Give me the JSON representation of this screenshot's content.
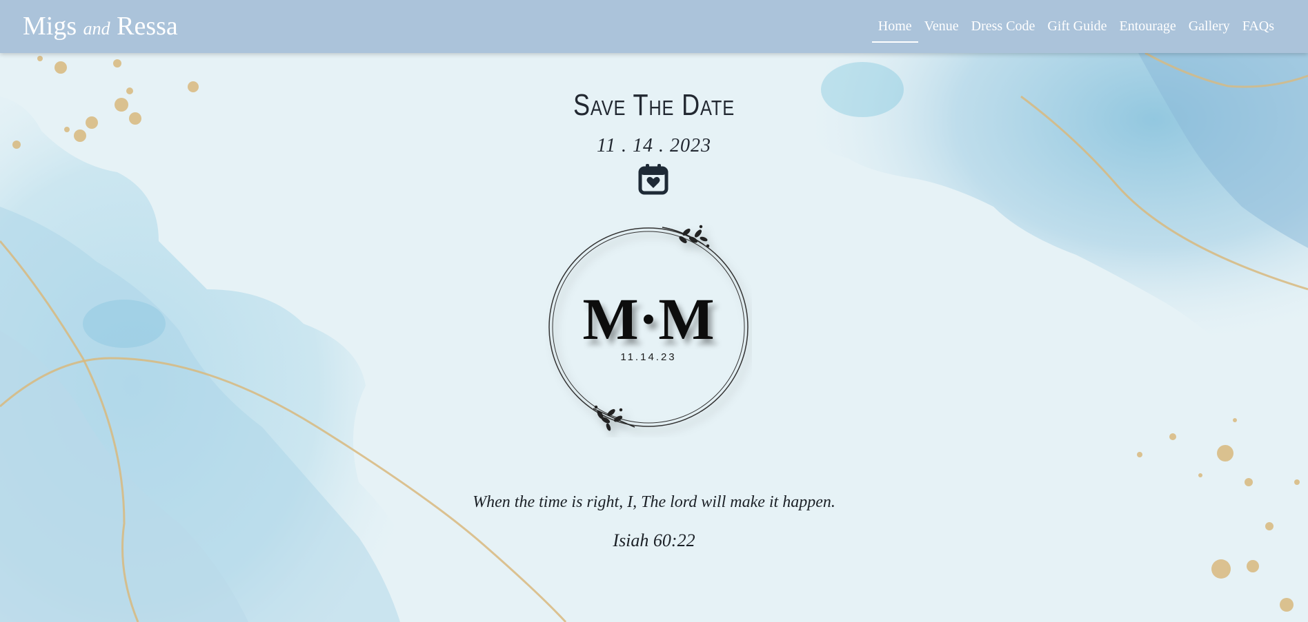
{
  "header": {
    "brand_first": "Migs",
    "brand_and": "and",
    "brand_second": "Ressa"
  },
  "nav": {
    "items": [
      "Home",
      "Venue",
      "Dress Code",
      "Gift Guide",
      "Entourage",
      "Gallery",
      "FAQs"
    ],
    "active": "Home"
  },
  "hero": {
    "title": "Save The Date",
    "date": "11 . 14 . 2023",
    "calendar_icon": "calendar-heart-icon",
    "monogram": "M·M",
    "monogram_date": "11.14.23",
    "verse": "When the time is right, I, The lord will make it happen.",
    "verse_ref": "Isiah 60:22"
  },
  "colors": {
    "navbar": "#abc3da",
    "background": "#e8f3f7",
    "watercolor_blue": "#a9d3e6",
    "gold_accent": "#d8b97e",
    "text_dark": "#222831"
  }
}
